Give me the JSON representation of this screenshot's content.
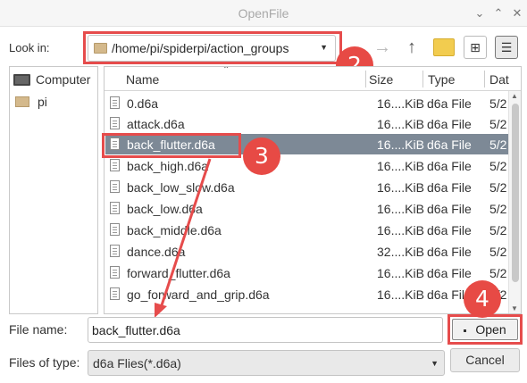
{
  "window": {
    "title": "OpenFile",
    "minimize_glyph": "⌄",
    "maximize_glyph": "⌃",
    "close_glyph": "✕"
  },
  "toolbar": {
    "look_in_label": "Look in:",
    "look_in_path": "/home/pi/spiderpi/action_groups",
    "back_icon": "←",
    "forward_icon": "→",
    "up_icon": "↑",
    "new_folder_icon": "new-folder-icon",
    "grid_view_icon": "⊞",
    "list_view_icon": "☰"
  },
  "sidebar": {
    "items": [
      {
        "label": "Computer",
        "icon": "computer-icon"
      },
      {
        "label": "pi",
        "icon": "folder-icon"
      }
    ]
  },
  "filelist": {
    "columns": [
      "Name",
      "Size",
      "Type",
      "Dat"
    ],
    "rows": [
      {
        "name": "0.d6a",
        "size": "16....KiB",
        "type": "d6a File",
        "date": "5/2"
      },
      {
        "name": "attack.d6a",
        "size": "16....KiB",
        "type": "d6a File",
        "date": "5/2"
      },
      {
        "name": "back_flutter.d6a",
        "size": "16....KiB",
        "type": "d6a File",
        "date": "5/2",
        "selected": true
      },
      {
        "name": "back_high.d6a",
        "size": "16....KiB",
        "type": "d6a File",
        "date": "5/2"
      },
      {
        "name": "back_low_slow.d6a",
        "size": "16....KiB",
        "type": "d6a File",
        "date": "5/2"
      },
      {
        "name": "back_low.d6a",
        "size": "16....KiB",
        "type": "d6a File",
        "date": "5/2"
      },
      {
        "name": "back_middle.d6a",
        "size": "16....KiB",
        "type": "d6a File",
        "date": "5/2"
      },
      {
        "name": "dance.d6a",
        "size": "32....KiB",
        "type": "d6a File",
        "date": "5/2"
      },
      {
        "name": "forward_flutter.d6a",
        "size": "16....KiB",
        "type": "d6a File",
        "date": "5/2"
      },
      {
        "name": "go_forward_and_grip.d6a",
        "size": "16....KiB",
        "type": "d6a File",
        "date": "5/2"
      }
    ]
  },
  "footer": {
    "file_name_label": "File name:",
    "file_name_value": "back_flutter.d6a",
    "file_type_label": "Files of type:",
    "file_type_value": "d6a Flies(*.d6a)",
    "open_label": "Open",
    "cancel_label": "Cancel"
  },
  "annotations": {
    "step2": "2",
    "step3": "3",
    "step4": "4",
    "highlight_color": "#e64c4c"
  },
  "colors": {
    "selected_row": "#7d8996",
    "badge": "#e74a45"
  }
}
